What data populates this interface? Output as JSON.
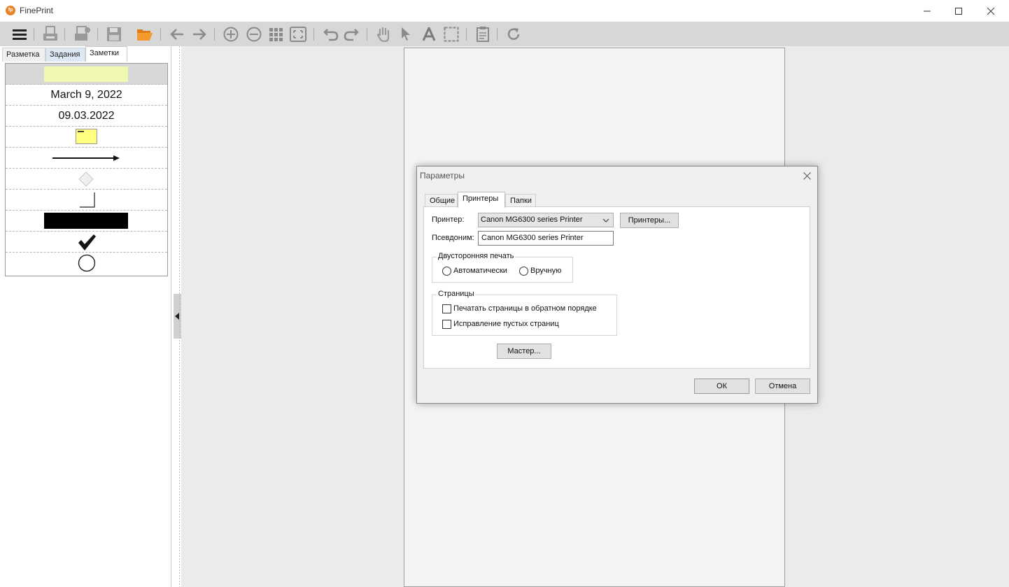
{
  "app": {
    "title": "FinePrint",
    "logo_text": "fp"
  },
  "window_controls": [
    "minimize-icon",
    "maximize-icon",
    "close-icon"
  ],
  "toolbar": {
    "icons": [
      "menu-icon",
      "print-icon",
      "print-settings-icon",
      "save-icon",
      "open-folder-icon",
      "back-arrow-icon",
      "forward-arrow-icon",
      "zoom-in-icon",
      "zoom-out-icon",
      "grid-view-icon",
      "fit-page-icon",
      "undo-icon",
      "redo-icon",
      "hand-tool-icon",
      "pointer-icon",
      "text-tool-icon",
      "select-region-icon",
      "page-settings-icon",
      "refresh-icon"
    ]
  },
  "left_panel": {
    "tabs": [
      {
        "label": "Разметка"
      },
      {
        "label": "Задания"
      },
      {
        "label": "Заметки"
      }
    ],
    "notes": {
      "date_long": "March 9, 2022",
      "date_short": "09.03.2022"
    }
  },
  "dialog": {
    "title": "Параметры",
    "tabs": [
      {
        "label": "Общие"
      },
      {
        "label": "Принтеры"
      },
      {
        "label": "Папки"
      }
    ],
    "active_tab": "Принтеры",
    "printer_label": "Принтер:",
    "printer_value": "Canon MG6300 series Printer",
    "printers_button": "Принтеры...",
    "alias_label": "Псевдоним:",
    "alias_value": "Canon MG6300 series Printer",
    "duplex_group": "Двусторонняя печать",
    "duplex_auto": "Автоматически",
    "duplex_manual": "Вручную",
    "pages_group": "Страницы",
    "reverse_order": "Печатать страницы в обратном порядке",
    "fix_blank": "Исправление пустых страниц",
    "wizard_button": "Мастер...",
    "ok_button": "ОК",
    "cancel_button": "Отмена"
  },
  "colors": {
    "toolbar_bg": "#d7d7d7",
    "workspace_bg": "#ebebeb",
    "accent_orange": "#e8832a",
    "toolbar_icon": "#9a9a9a",
    "sticky_yellow": "#ffff80"
  }
}
